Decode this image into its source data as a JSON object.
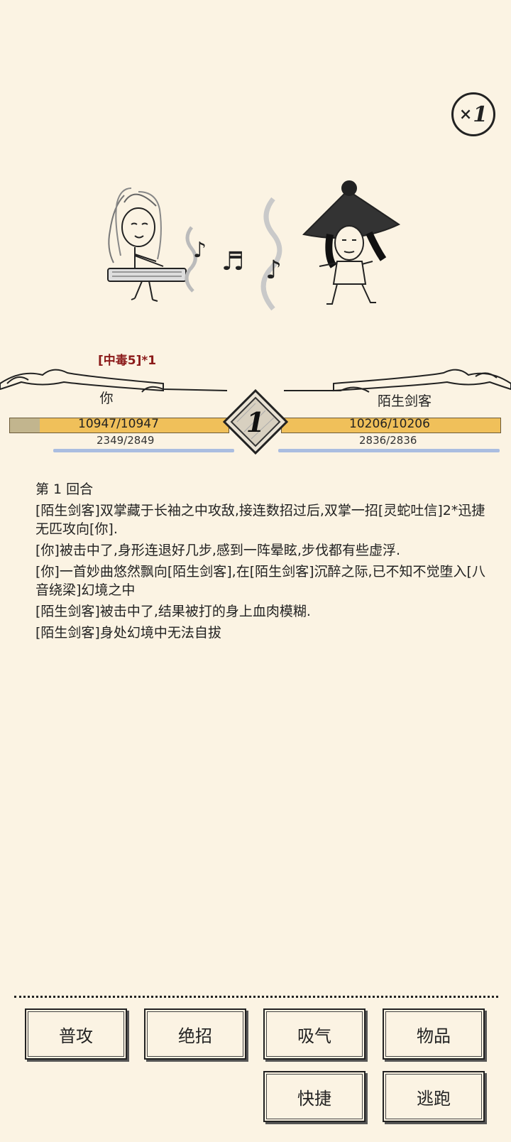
{
  "speed": {
    "prefix": "×",
    "value": "1"
  },
  "status_effect": "[中毒5]*1",
  "player": {
    "name": "你",
    "hp": "10947/10947",
    "mp": "2349/2849",
    "hp_fraction": 1.0,
    "mp_fraction": 0.824
  },
  "enemy": {
    "name": "陌生剑客",
    "hp": "10206/10206",
    "mp": "2836/2836",
    "hp_fraction": 1.0,
    "mp_fraction": 1.0
  },
  "round_number": "1",
  "battle_log": [
    "第 1 回合",
    "[陌生剑客]双掌藏于长袖之中攻敌,接连数招过后,双掌一招[灵蛇吐信]2*迅捷无匹攻向[你].",
    "[你]被击中了,身形连退好几步,感到一阵晕眩,步伐都有些虚浮.",
    "[你]一首妙曲悠然飘向[陌生剑客],在[陌生剑客]沉醉之际,已不知不觉堕入[八音绕梁]幻境之中",
    "[陌生剑客]被击中了,结果被打的身上血肉模糊.",
    "[陌生剑客]身处幻境中无法自拔"
  ],
  "actions": {
    "attack": "普攻",
    "ultimate": "绝招",
    "breathe": "吸气",
    "items": "物品",
    "quick": "快捷",
    "flee": "逃跑"
  }
}
